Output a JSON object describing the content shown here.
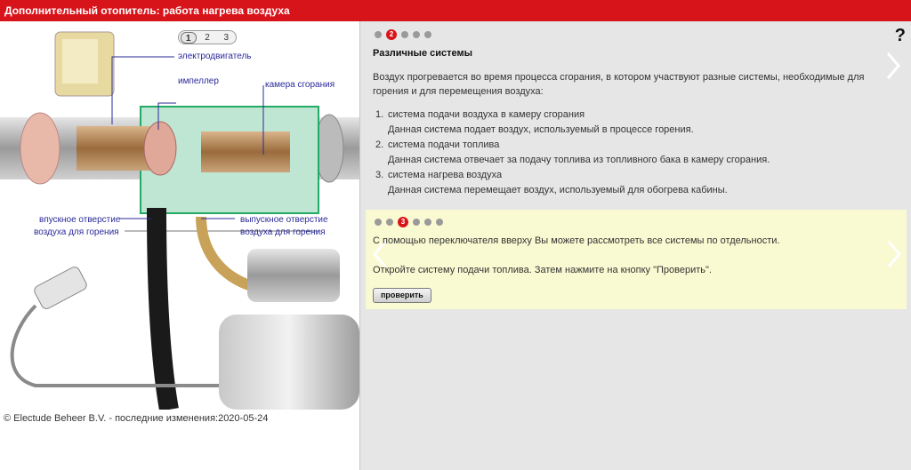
{
  "title": "Дополнительный отопитель: работа нагрева воздуха",
  "pager": {
    "items": [
      "1",
      "2",
      "3"
    ],
    "active": "1"
  },
  "diagram_labels": {
    "motor": "электродвигатель",
    "impeller": "импеллер",
    "chamber": "камера сгорания",
    "inlet_1": "впускное отверстие",
    "inlet_2": "воздуха для горения",
    "outlet_1": "выпускное отверстие",
    "outlet_2": "воздуха для горения"
  },
  "copyright": "© Electude Beheer B.V. - последние изменения:2020-05-24",
  "panel": {
    "step_active": "2",
    "help": "?",
    "heading": "Различные системы",
    "intro": "Воздух прогревается во время процесса сгорания, в котором участвуют разные системы, необходимые для горения и для перемещения воздуха:",
    "systems": [
      {
        "num": "1.",
        "name": "система подачи воздуха в камеру сгорания",
        "desc": "Данная система подает воздух, используемый в процессе горения."
      },
      {
        "num": "2.",
        "name": "система подачи топлива",
        "desc": "Данная система отвечает за подачу топлива из топливного бака в камеру сгорания."
      },
      {
        "num": "3.",
        "name": "система нагрева воздуха",
        "desc": "Данная система перемещает воздух, используемый для обогрева кабины."
      }
    ]
  },
  "task": {
    "step_active": "3",
    "line1": "С помощью переключателя вверху Вы можете рассмотреть все системы по отдельности.",
    "line2": "Откройте систему подачи топлива. Затем нажмите на кнопку \"Проверить\".",
    "button": "проверить"
  },
  "colors": {
    "brand": "#d8141b",
    "note_bg": "#fafad2",
    "panel_bg": "#e6e6e6",
    "label": "#2a2a9a"
  }
}
